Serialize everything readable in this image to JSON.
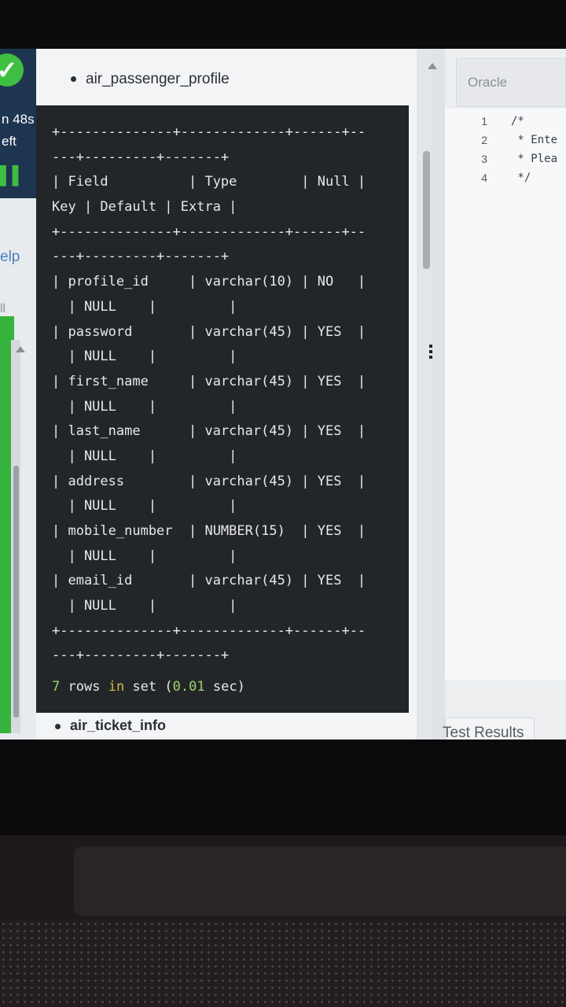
{
  "left_panel": {
    "timer_fragment": "n 48s",
    "left_fragment": "eft",
    "help_fragment": "elp",
    "all_fragment": "ll"
  },
  "content": {
    "section1": "air_passenger_profile",
    "section2": "air_ticket_info",
    "terminal": {
      "lines": [
        "+--------------+-------------+------+--",
        "---+---------+-------+",
        "| Field          | Type        | Null |",
        "Key | Default | Extra |",
        "+--------------+-------------+------+--",
        "---+---------+-------+",
        "| profile_id     | varchar(10) | NO   |",
        "  | NULL    |         |",
        "| password       | varchar(45) | YES  |",
        "  | NULL    |         |",
        "| first_name     | varchar(45) | YES  |",
        "  | NULL    |         |",
        "| last_name      | varchar(45) | YES  |",
        "  | NULL    |         |",
        "| address        | varchar(45) | YES  |",
        "  | NULL    |         |",
        "| mobile_number  | NUMBER(15)  | YES  |",
        "  | NULL    |         |",
        "| email_id       | varchar(45) | YES  |",
        "  | NULL    |         |",
        "+--------------+-------------+------+--",
        "---+---------+-------+"
      ],
      "summary": {
        "count": "7",
        "rows": "rows",
        "in": "in",
        "set": "set",
        "paren_open": "(",
        "time": "0.01",
        "sec": "sec)"
      }
    }
  },
  "editor": {
    "dialect": "Oracle",
    "line_numbers": [
      "1",
      "2",
      "3",
      "4"
    ],
    "code_lines": [
      "/*",
      " * Ente",
      " * Plea",
      " */"
    ],
    "results_tab": "Test Results"
  }
}
